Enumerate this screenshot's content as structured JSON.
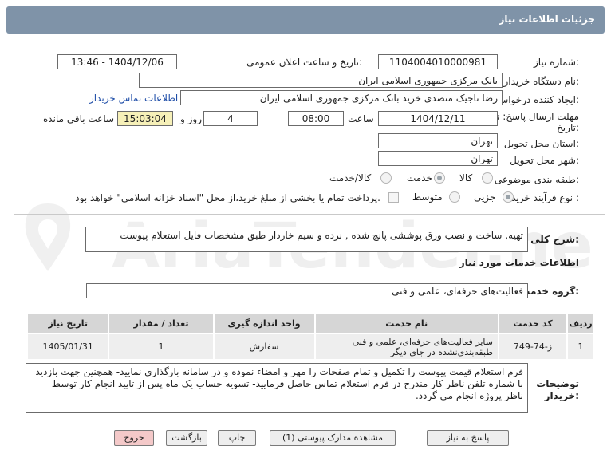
{
  "header": {
    "title": "جزئیات اطلاعات نیاز"
  },
  "fields": {
    "need_number_label": "شماره نیاز:",
    "need_number": "1104004010000981",
    "announce_label": "تاریخ و ساعت اعلان عمومی:",
    "announce_value": "1404/12/06 - 13:46",
    "buyer_org_label": "نام دستگاه خریدار:",
    "buyer_org": "بانک مرکزی جمهوری اسلامی ایران",
    "creator_label": "ایجاد کننده درخواست:",
    "creator": "رضا تاجیک متصدی خرید بانک مرکزی جمهوری اسلامی ایران",
    "contact_link": "اطلاعات تماس خریدار",
    "deadline_label_1": "مهلت ارسال پاسخ: تا",
    "deadline_label_2": "تاریخ:",
    "deadline_date": "1404/12/11",
    "time_label": "ساعت",
    "deadline_time": "08:00",
    "days_value": "4",
    "days_label": "روز و",
    "remaining_time": "15:03:04",
    "remaining_label": "ساعت باقی مانده",
    "province_label": "استان محل تحویل:",
    "province": "تهران",
    "city_label": "شهر محل تحویل:",
    "city": "تهران",
    "category_label": "طبقه بندی موضوعی:",
    "category_options": [
      "کالا",
      "خدمت",
      "کالا/خدمت"
    ],
    "category_selected": "خدمت",
    "process_label": "نوع فرآیند خرید :",
    "process_options": [
      "جزیی",
      "متوسط"
    ],
    "process_selected": "جزیی",
    "payment_note": "پرداخت تمام یا بخشی از مبلغ خرید،از محل \"اسناد خزانه اسلامی\" خواهد بود."
  },
  "description": {
    "label": "شرح کلی نیاز:",
    "value": "تهیه, ساخت و نصب ورق پوششی پانچ شده , نرده و سیم خاردار طبق مشخصات فایل استعلام پیوست"
  },
  "services": {
    "section_title": "اطلاعات خدمات مورد نیاز",
    "group_label": "گروه خدمت:",
    "group_value": "فعالیت‌های حرفه‌ای، علمی و فنی"
  },
  "table": {
    "headers": [
      "ردیف",
      "کد خدمت",
      "نام خدمت",
      "واحد اندازه گیری",
      "تعداد / مقدار",
      "تاریخ نیاز"
    ],
    "rows": [
      [
        "1",
        "ز-74-749",
        "سایر فعالیت‌های حرفه‌ای، علمی و فنی طبقه‌بندی‌نشده در جای دیگر",
        "سفارش",
        "1",
        "1405/01/31"
      ]
    ]
  },
  "buyer_notes": {
    "label_1": "توضیحات",
    "label_2": "خریدار:",
    "value": "فرم استعلام قیمت پیوست را تکمیل و تمام صفحات را مهر و امضاء نموده و در سامانه بارگذاری نمایید- همچنین جهت بازدید با شماره تلفن ناظر کار مندرج در فرم استعلام تماس حاصل فرمایید- تسویه حساب یک ماه پس از تایید انجام کار توسط ناظر پروژه انجام می گردد."
  },
  "buttons": {
    "reply": "پاسخ به نیاز",
    "view_docs": "مشاهده مدارک پیوستی (1)",
    "print": "چاپ",
    "back": "بازگشت",
    "exit": "خروج"
  },
  "watermark": {
    "text": "AriaTender.net"
  },
  "colors": {
    "header": "#7f93a8",
    "highlight": "#f6f0b8",
    "link": "#1f4ea8",
    "exit_button": "#f4c9c9"
  }
}
